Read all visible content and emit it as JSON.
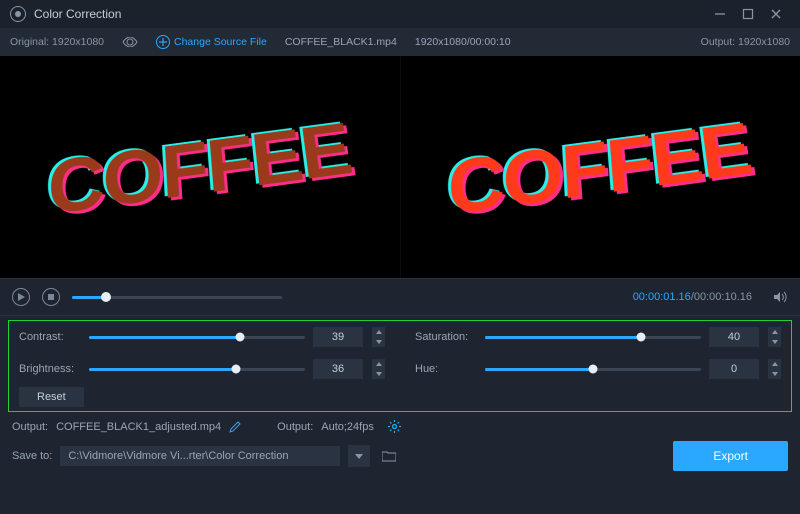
{
  "window": {
    "title": "Color Correction"
  },
  "topbar": {
    "original_label": "Original:",
    "original_res": "1920x1080",
    "change_source": "Change Source File",
    "filename": "COFFEE_BLACK1.mp4",
    "res_time": "1920x1080/00:00:10",
    "output_label": "Output:",
    "output_res": "1920x1080"
  },
  "preview": {
    "text": "COFFEE"
  },
  "timeline": {
    "current": "00:00:01.16",
    "total": "00:00:10.16",
    "progress_pct": 16
  },
  "controls": {
    "contrast": {
      "label": "Contrast:",
      "value": 39,
      "pct": 70
    },
    "brightness": {
      "label": "Brightness:",
      "value": 36,
      "pct": 68
    },
    "saturation": {
      "label": "Saturation:",
      "value": 40,
      "pct": 72
    },
    "hue": {
      "label": "Hue:",
      "value": 0,
      "pct": 50
    },
    "reset_label": "Reset"
  },
  "output": {
    "label": "Output:",
    "filename": "COFFEE_BLACK1_adjusted.mp4",
    "format_label": "Output:",
    "format_value": "Auto;24fps"
  },
  "save": {
    "label": "Save to:",
    "path": "C:\\Vidmore\\Vidmore Vi...rter\\Color Correction"
  },
  "actions": {
    "export": "Export"
  }
}
